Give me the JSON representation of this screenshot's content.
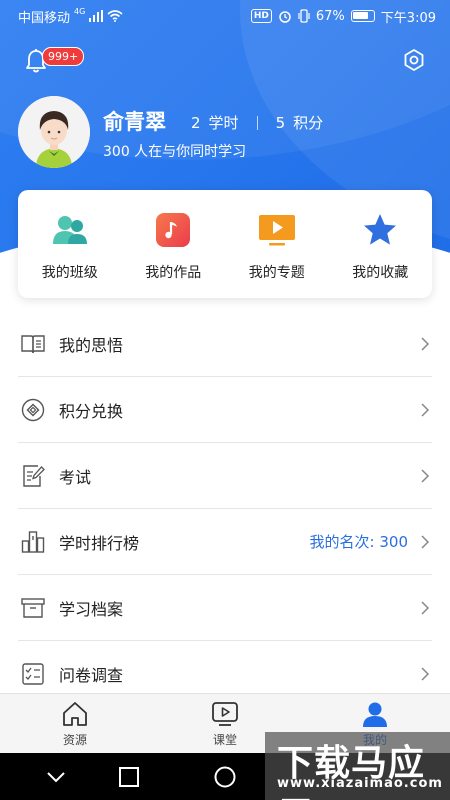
{
  "status_bar": {
    "carrier": "中国移动",
    "network": "4G",
    "hd": "HD",
    "battery": "67%",
    "time": "下午3:09"
  },
  "header": {
    "notification_badge": "999+",
    "user_name": "俞青翠",
    "study_hours_value": "2",
    "study_hours_label": "学时",
    "points_value": "5",
    "points_label": "积分",
    "subtext": "300 人在与你同时学习"
  },
  "quick_actions": [
    {
      "label": "我的班级",
      "icon": "class-icon",
      "color": "#3cb7a8"
    },
    {
      "label": "我的作品",
      "icon": "music-note-icon",
      "color": "#f0504c"
    },
    {
      "label": "我的专题",
      "icon": "play-video-icon",
      "color": "#f08a1c"
    },
    {
      "label": "我的收藏",
      "icon": "star-icon",
      "color": "#2a6fe0"
    }
  ],
  "menu": [
    {
      "label": "我的思悟",
      "icon": "book-icon",
      "value": ""
    },
    {
      "label": "积分兑换",
      "icon": "exchange-icon",
      "value": ""
    },
    {
      "label": "考试",
      "icon": "exam-edit-icon",
      "value": ""
    },
    {
      "label": "学时排行榜",
      "icon": "ranking-icon",
      "value": "我的名次: 300"
    },
    {
      "label": "学习档案",
      "icon": "archive-box-icon",
      "value": ""
    },
    {
      "label": "问卷调查",
      "icon": "checklist-icon",
      "value": ""
    }
  ],
  "tabs": [
    {
      "label": "资源",
      "icon": "home-icon",
      "active": false
    },
    {
      "label": "课堂",
      "icon": "video-play-icon",
      "active": false
    },
    {
      "label": "我的",
      "icon": "person-icon",
      "active": true
    }
  ],
  "watermark": {
    "line1": "下载马应用",
    "line2": "www.xiazaimao.com"
  },
  "colors": {
    "primary": "#1f6de8",
    "badge": "#f03b3b",
    "rank_text": "#2a6fe0"
  }
}
